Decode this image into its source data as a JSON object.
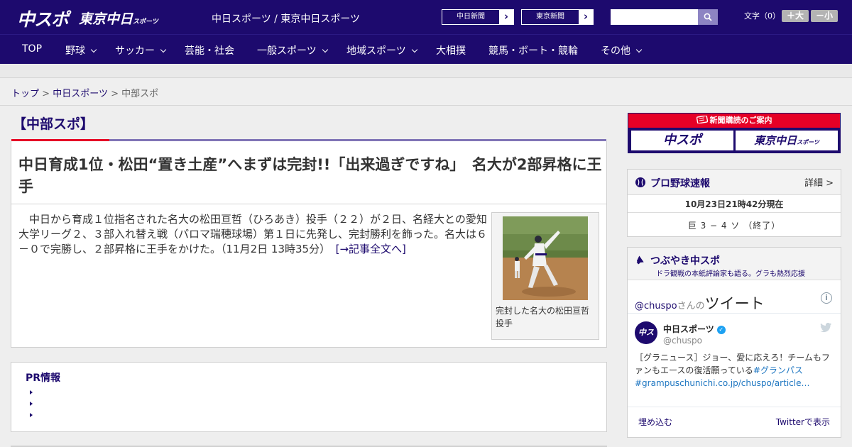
{
  "header": {
    "logo_main": "中スポ",
    "logo_tokyo": "東京中日",
    "logo_tokyo_small": "スポーツ",
    "site_title": "中日スポーツ / 東京中日スポーツ",
    "btn_chunichi": "中日新聞",
    "btn_tokyo": "東京新聞",
    "arrow": "›",
    "search_placeholder": "",
    "font_label": "文字（0）",
    "font_larger": "＋大",
    "font_smaller": "－小",
    "brand_color": "#1d0a6e",
    "accent_color": "#e60026"
  },
  "nav": {
    "items": [
      {
        "label": "TOP",
        "has_menu": false
      },
      {
        "label": "野球",
        "has_menu": true
      },
      {
        "label": "サッカー",
        "has_menu": true
      },
      {
        "label": "芸能・社会",
        "has_menu": false
      },
      {
        "label": "一般スポーツ",
        "has_menu": true
      },
      {
        "label": "地域スポーツ",
        "has_menu": true
      },
      {
        "label": "大相撲",
        "has_menu": false
      },
      {
        "label": "競馬・ボート・競輪",
        "has_menu": false
      },
      {
        "label": "その他",
        "has_menu": true
      }
    ]
  },
  "breadcrumb": {
    "items": [
      "トップ",
      "中日スポーツ",
      "中部スポ"
    ],
    "separator": ">"
  },
  "main": {
    "section_title": "【中部スポ】",
    "headline": "中日育成1位・松田“置き土産”へまずは完封!!「出来過ぎですね」　名大が2部昇格に王手",
    "lead": "中日から育成１位指名された名大の松田亘哲（ひろあき）投手（２２）が２日、名経大との愛知大学リーグ２、３部入れ替え戦（パロマ瑞穂球場）第１日に先発し、完封勝利を飾った。名大は６－０で完勝し、２部昇格に王手をかけた。（11月2日 13時35分）",
    "read_more": "[→記事全文へ]",
    "photo_caption": "完封した名大の松田亘哲投手",
    "pr_title": "PR情報"
  },
  "sidebar": {
    "ad_header": "新聞購読のご案内",
    "ad_chuspo": "中スポ",
    "ad_tokyo": "東京中日",
    "ad_tokyo_small": "スポーツ",
    "baseball": {
      "title": "プロ野球速報",
      "more": "詳細 >",
      "timestamp": "10月23日21時42分現在",
      "score": "巨 3 − 4 ソ （終了）"
    },
    "tsubuyaki": {
      "title": "つぶやき中スポ",
      "subtitle": "ドラ観戦の本紙評論家も語る。グラも熱烈応援"
    },
    "twitter": {
      "handle": "@chuspo",
      "handle_suffix": "さんの",
      "heading": "ツイート",
      "info": "i",
      "account_name": "中日スポーツ",
      "username": "@chuspo",
      "avatar_text": "中スポ",
      "tweet_text": "［グラニュース］ジョー、愛に応えろ！チームもファンもエースの復活願っている",
      "tweet_hashtag": "#グランパス",
      "tweet_link": "#grampuschunichi.co.jp/chuspo/article…",
      "embed": "埋め込む",
      "view_on_twitter": "Twitterで表示"
    }
  }
}
